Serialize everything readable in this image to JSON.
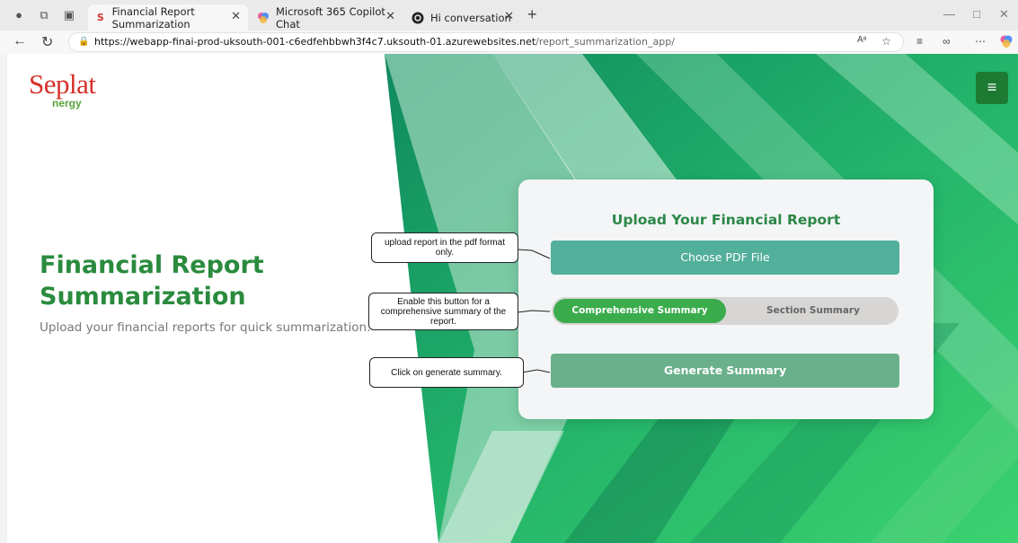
{
  "browser": {
    "tabs": [
      {
        "title": "Financial Report Summarization",
        "favicon": "S",
        "active": true
      },
      {
        "title": "Microsoft 365 Copilot Chat",
        "favicon": "copilot-icon",
        "active": false
      },
      {
        "title": "Hi conversation",
        "favicon": "chatgpt-icon",
        "active": false
      }
    ],
    "url_host": "https://webapp-finai-prod-uksouth-001-c6edfehbbwh3f4c7.uksouth-01.azurewebsites.net",
    "url_path": "/report_summarization_app/",
    "reader_label": "Aᵃ"
  },
  "brand": {
    "logo_text": "Seplat",
    "logo_sub": "nergy",
    "primary_color": "#2a8b3e",
    "logo_color": "#d5312a"
  },
  "menu": {
    "icon": "≡"
  },
  "hero": {
    "title_line1": "Financial Report",
    "title_line2": "Summarization",
    "subtitle": "Upload your financial reports for quick summarization."
  },
  "card": {
    "title": "Upload Your Financial Report",
    "choose_file_label": "Choose PDF File",
    "toggle_options": [
      "Comprehensive Summary",
      "Section Summary"
    ],
    "selected_option": "Comprehensive Summary",
    "generate_label": "Generate Summary"
  },
  "callouts": [
    {
      "text": "upload report in the pdf format only."
    },
    {
      "text": "Enable this button for a comprehensive summary of the report."
    },
    {
      "text": "Click on generate summary."
    }
  ]
}
